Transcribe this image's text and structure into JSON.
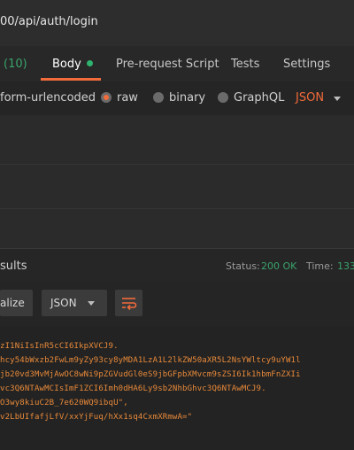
{
  "request": {
    "url": "00/api/auth/login"
  },
  "tabs": [
    {
      "label": "(10)"
    },
    {
      "label": "Body"
    },
    {
      "label": "Pre-request Script"
    },
    {
      "label": "Tests"
    },
    {
      "label": "Settings"
    }
  ],
  "body_options": {
    "urlencoded": "form-urlencoded",
    "raw": "raw",
    "binary": "binary",
    "graphql": "GraphQL",
    "format": "JSON"
  },
  "response": {
    "title": "sults",
    "status_label": "Status:",
    "status_value": "200 OK",
    "time_label": "Time:",
    "time_value": "133",
    "beautify_label": "alize",
    "format_label": "JSON"
  },
  "response_lines": [
    "zI1NiIsInR5cCI6IkpXVCJ9.",
    "hcy54bWxzb2FwLm9yZy93cy8yMDA1LzA1L2lkZW50aXR5L2NsYWltcy9uYW1l",
    "jb20vd3MvMjAwOC8wNi9pZGVudGl0eS9jbGFpbXMvcm9sZSI6Ik1hbmFnZXIi",
    "vc3Q6NTAwMCIsImF1ZCI6Imh0dHA6Ly9sb2NhbGhvc3Q6NTAwMCJ9.",
    "O3wy8kiuC2B_7e620WQ9ibqU\",",
    "v2LbUIfafjLfV/xxYjFuq/hXx1sq4CxmXRmwA=\""
  ],
  "colors": {
    "accent": "#f26b3a",
    "success": "#3aa36b",
    "code": "#e98a3a"
  }
}
